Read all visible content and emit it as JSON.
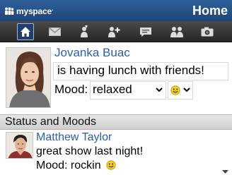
{
  "header": {
    "logo_text": "myspace",
    "logo_suffix": ".",
    "title": "Home"
  },
  "toolbar": {
    "items": [
      {
        "name": "home",
        "icon": "home-icon",
        "active": true
      },
      {
        "name": "mail",
        "icon": "envelope-icon"
      },
      {
        "name": "status",
        "icon": "status-update-icon"
      },
      {
        "name": "add-friend",
        "icon": "add-friend-icon"
      },
      {
        "name": "comments",
        "icon": "comment-icon"
      },
      {
        "name": "friends",
        "icon": "friends-icon"
      },
      {
        "name": "photos",
        "icon": "camera-icon"
      }
    ]
  },
  "profile": {
    "name": "Jovanka Buac",
    "status": "is having lunch with friends!",
    "mood_label": "Mood:",
    "mood_value": "relaxed",
    "mood_emoticon": "smiley-icon"
  },
  "section": {
    "title": "Status and Moods"
  },
  "friends": [
    {
      "name": "Matthew Taylor",
      "status": "great show last night!",
      "mood": "Mood: rockin",
      "emoticon": "smiley-icon"
    }
  ],
  "colors": {
    "header_blue": "#1d4577",
    "link_blue": "#2e5fa8",
    "toolbar_dark": "#262626",
    "smiley_yellow": "#f5d21b"
  }
}
